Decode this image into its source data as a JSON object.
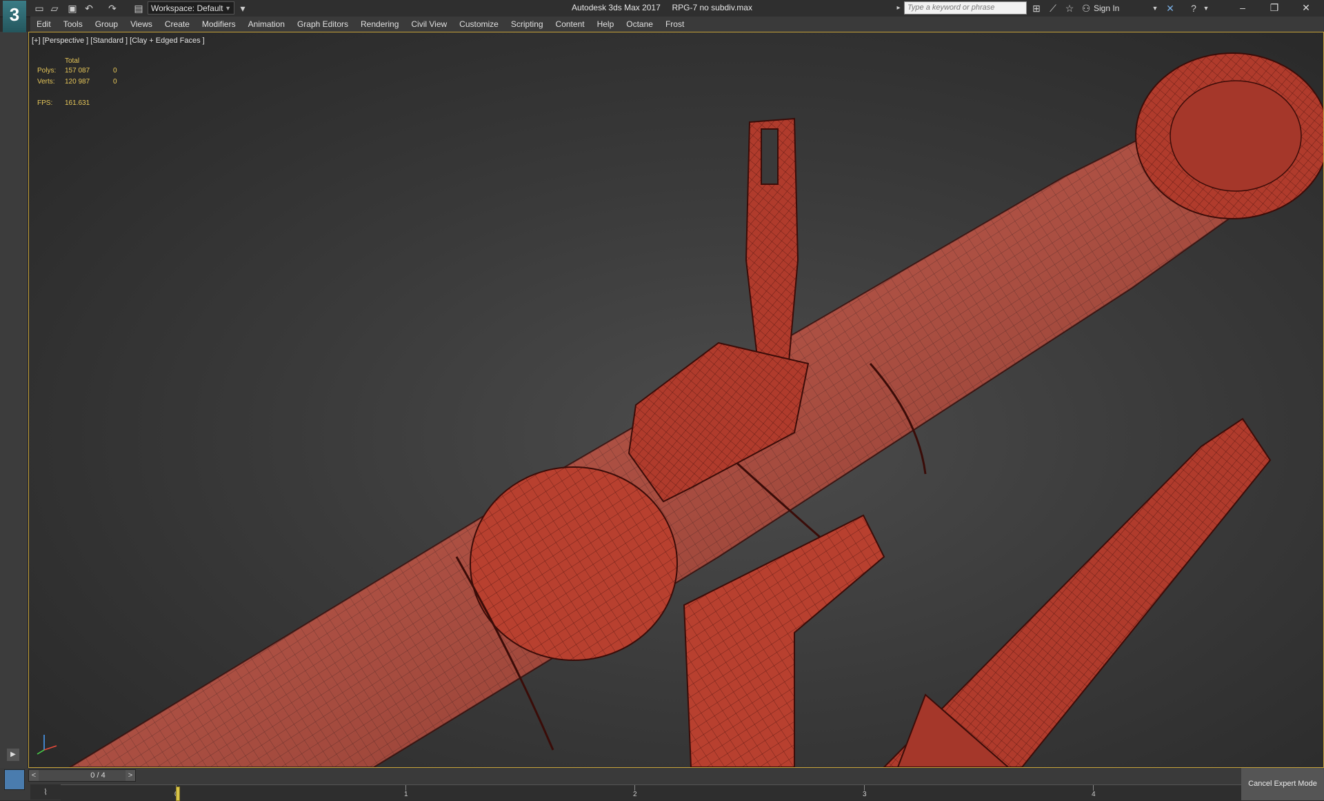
{
  "window": {
    "app_name": "Autodesk 3ds Max 2017",
    "file_name": "RPG-7 no subdiv.max",
    "logo_text": "3"
  },
  "toolbar": {
    "workspace_label": "Workspace: Default",
    "search_placeholder": "Type a keyword or phrase",
    "sign_in_label": "Sign In"
  },
  "menu": {
    "items": [
      "Edit",
      "Tools",
      "Group",
      "Views",
      "Create",
      "Modifiers",
      "Animation",
      "Graph Editors",
      "Rendering",
      "Civil View",
      "Customize",
      "Scripting",
      "Content",
      "Help",
      "Octane",
      "Frost"
    ]
  },
  "viewport": {
    "label": "[+] [Perspective ] [Standard ] [Clay + Edged Faces ]",
    "stats": {
      "total_header": "Total",
      "polys_label": "Polys:",
      "polys_total": "157 087",
      "polys_selected": "0",
      "verts_label": "Verts:",
      "verts_total": "120 987",
      "verts_selected": "0",
      "fps_label": "FPS:",
      "fps_value": "161.631"
    },
    "model_color": "#b23a2e",
    "wire_color": "#5a1812"
  },
  "timeline": {
    "frame_counter": "0 / 4",
    "prev_label": "<",
    "next_label": ">",
    "ticks": [
      "0",
      "1",
      "2",
      "3",
      "4"
    ],
    "cancel_expert_label": "Cancel Expert Mode"
  },
  "colors": {
    "viewport_border": "#c8a43a",
    "stats_text": "#e8c85a"
  }
}
